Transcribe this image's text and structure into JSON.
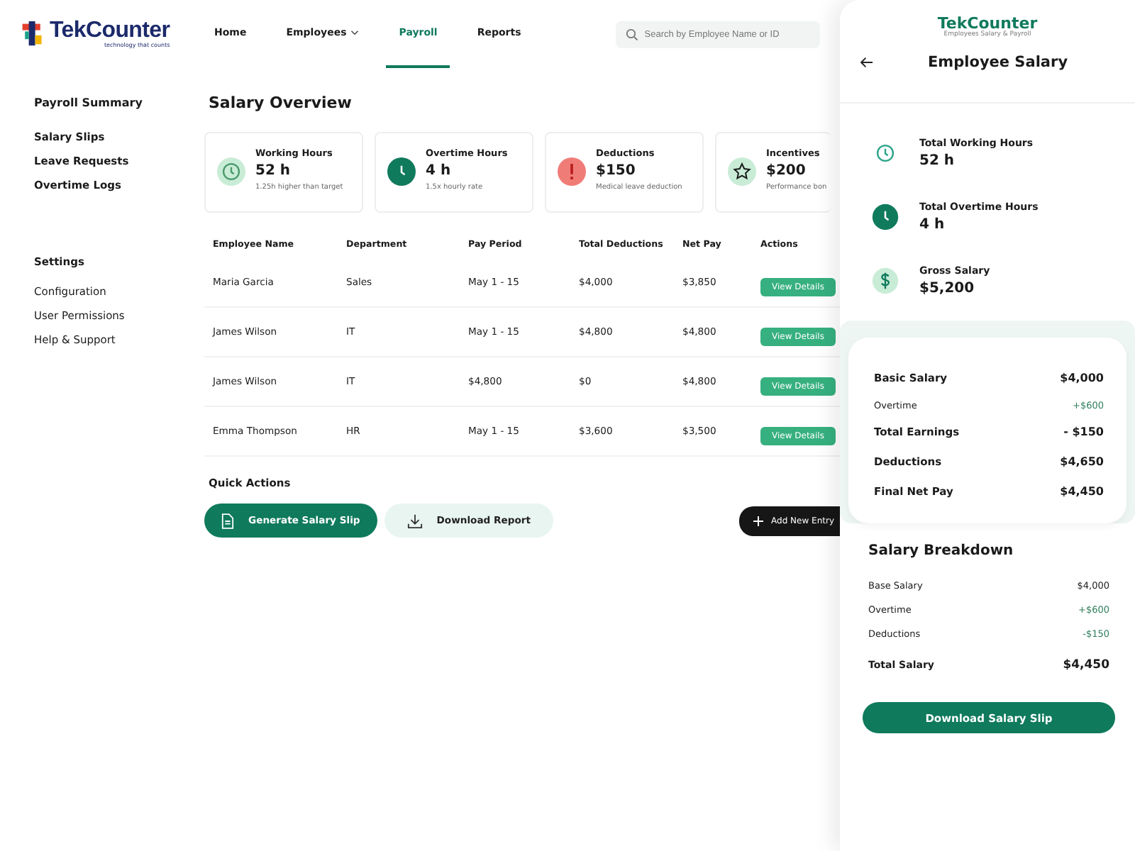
{
  "logo": {
    "brand": "TekCounter",
    "tagline": "technology that counts"
  },
  "nav": [
    {
      "label": "Home",
      "selected": false,
      "dropdown": false
    },
    {
      "label": "Employees",
      "selected": false,
      "dropdown": true
    },
    {
      "label": "Payroll",
      "selected": true,
      "dropdown": false
    },
    {
      "label": "Reports",
      "selected": false,
      "dropdown": false
    }
  ],
  "search": {
    "placeholder": "Search by Employee Name or ID"
  },
  "sidebar": {
    "title": "Payroll Summary",
    "items": [
      "Salary Slips",
      "Leave Requests",
      "Overtime Logs"
    ],
    "settings_title": "Settings",
    "settings_items": [
      "Configuration",
      "User Permissions",
      "Help & Support"
    ]
  },
  "overview": {
    "title": "Salary Overview",
    "cards": [
      {
        "kind": "hours",
        "label": "Working Hours",
        "value": "52 h",
        "note": "1.25h higher than target"
      },
      {
        "kind": "overtime",
        "label": "Overtime Hours",
        "value": "4 h",
        "note": "1.5x hourly rate"
      },
      {
        "kind": "deduction",
        "label": "Deductions",
        "value": "$150",
        "note": "Medical leave deduction"
      },
      {
        "kind": "incentive",
        "label": "Incentives",
        "value": "$200",
        "note": "Performance bon"
      }
    ]
  },
  "table": {
    "columns": [
      "Employee Name",
      "Department",
      "Pay Period",
      "Total Deductions",
      "Net Pay",
      "Actions"
    ],
    "rows": [
      [
        "Maria Garcia",
        "Sales",
        "May 1 - 15",
        "$4,000",
        "$3,850",
        "View Details"
      ],
      [
        "James Wilson",
        "IT",
        "May 1 - 15",
        "$4,800",
        "$4,800",
        "View Details"
      ],
      [
        "James Wilson",
        "IT",
        "$4,800",
        "$0",
        "$4,800",
        "View Details"
      ],
      [
        "Emma Thompson",
        "HR",
        "May 1 - 15",
        "$3,600",
        "$3,500",
        "View Details"
      ]
    ]
  },
  "quick_actions": {
    "title": "Quick Actions",
    "generate": "Generate Salary Slip",
    "download": "Download Report",
    "add": "Add New Entry"
  },
  "panel": {
    "brand": "TekCounter",
    "tagline": "Employees Salary & Payroll",
    "title": "Employee Salary",
    "stats": [
      {
        "kind": "hours",
        "label": "Total Working Hours",
        "value": "52 h"
      },
      {
        "kind": "overtime",
        "label": "Total Overtime Hours",
        "value": "4 h"
      },
      {
        "kind": "gross",
        "label": "Gross Salary",
        "value": "$5,200"
      }
    ],
    "summary": [
      {
        "kind": "main",
        "label": "Basic Salary",
        "value": "$4,000",
        "color": "#1a1a1a"
      },
      {
        "kind": "sub",
        "label": "Overtime",
        "value": "+$600",
        "color": "#2e7d5b"
      },
      {
        "kind": "main",
        "label": "Total Earnings",
        "value": "- $150",
        "color": "#1a1a1a"
      },
      {
        "kind": "main",
        "label": "Deductions",
        "value": "$4,650",
        "color": "#1a1a1a"
      },
      {
        "kind": "main",
        "label": "Final Net Pay",
        "value": "$4,450",
        "color": "#1a1a1a"
      }
    ],
    "breakdown_title": "Salary Breakdown",
    "breakdown": [
      {
        "kind": "sub",
        "label": "Base Salary",
        "value": "$4,000",
        "color": "#1a1a1a"
      },
      {
        "kind": "sub",
        "label": "Overtime",
        "value": "+$600",
        "color": "#2e7d5b"
      },
      {
        "kind": "sub",
        "label": "Deductions",
        "value": "-$150",
        "color": "#2e7d5b"
      },
      {
        "kind": "main",
        "label": "Total Salary",
        "value": "$4,450",
        "color": "#1a1a1a"
      }
    ],
    "button": "Download Salary Slip"
  }
}
